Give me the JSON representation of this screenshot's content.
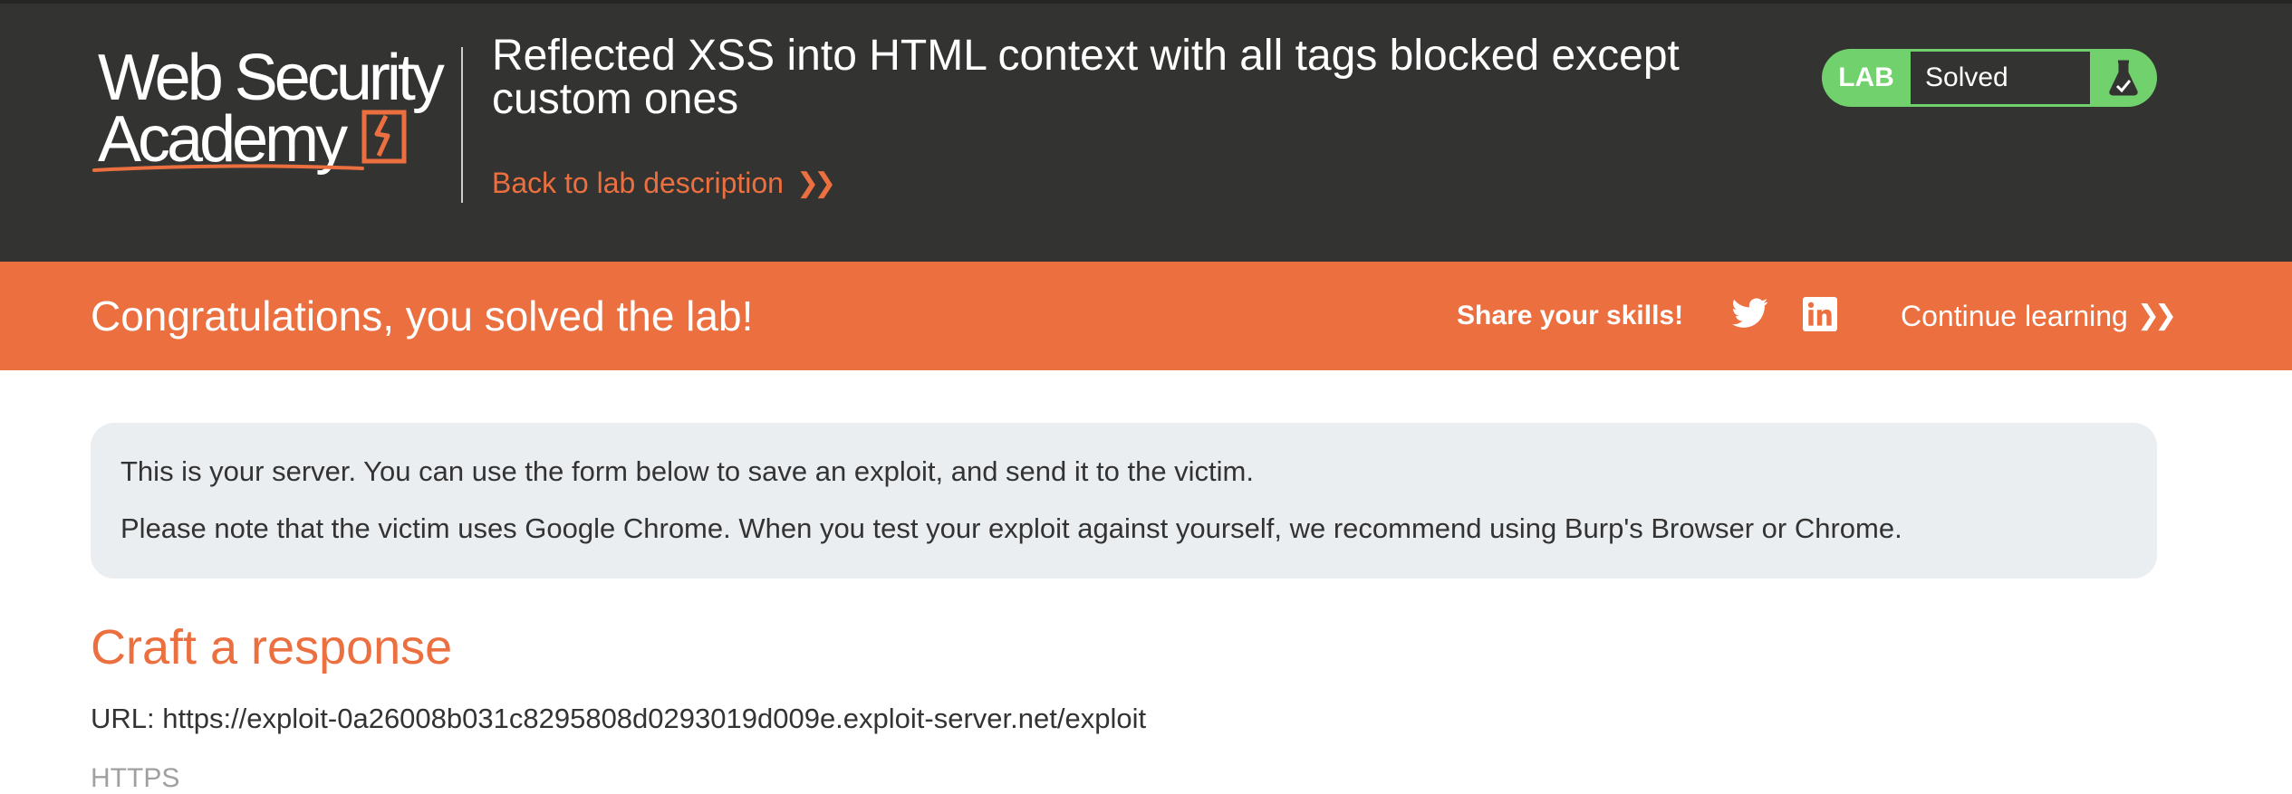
{
  "logo": {
    "line1": "Web Security",
    "line2": "Academy"
  },
  "header": {
    "title": "Reflected XSS into HTML context with all tags blocked except custom ones",
    "back_link": "Back to lab description",
    "lab_badge": "LAB",
    "status": "Solved"
  },
  "banner": {
    "message": "Congratulations, you solved the lab!",
    "share_label": "Share your skills!",
    "continue_label": "Continue learning",
    "social": [
      "twitter-icon",
      "linkedin-icon"
    ]
  },
  "notice": {
    "line1": "This is your server. You can use the form below to save an exploit, and send it to the victim.",
    "line2": "Please note that the victim uses Google Chrome. When you test your exploit against yourself, we recommend using Burp's Browser or Chrome."
  },
  "form": {
    "heading": "Craft a response",
    "url_text": "URL: https://exploit-0a26008b031c8295808d0293019d009e.exploit-server.net/exploit",
    "https_label": "HTTPS"
  },
  "colors": {
    "brand_orange": "#ec6f3f",
    "header_bg": "#333332",
    "success_green": "#70d16d",
    "notice_bg": "#ebeef1"
  }
}
